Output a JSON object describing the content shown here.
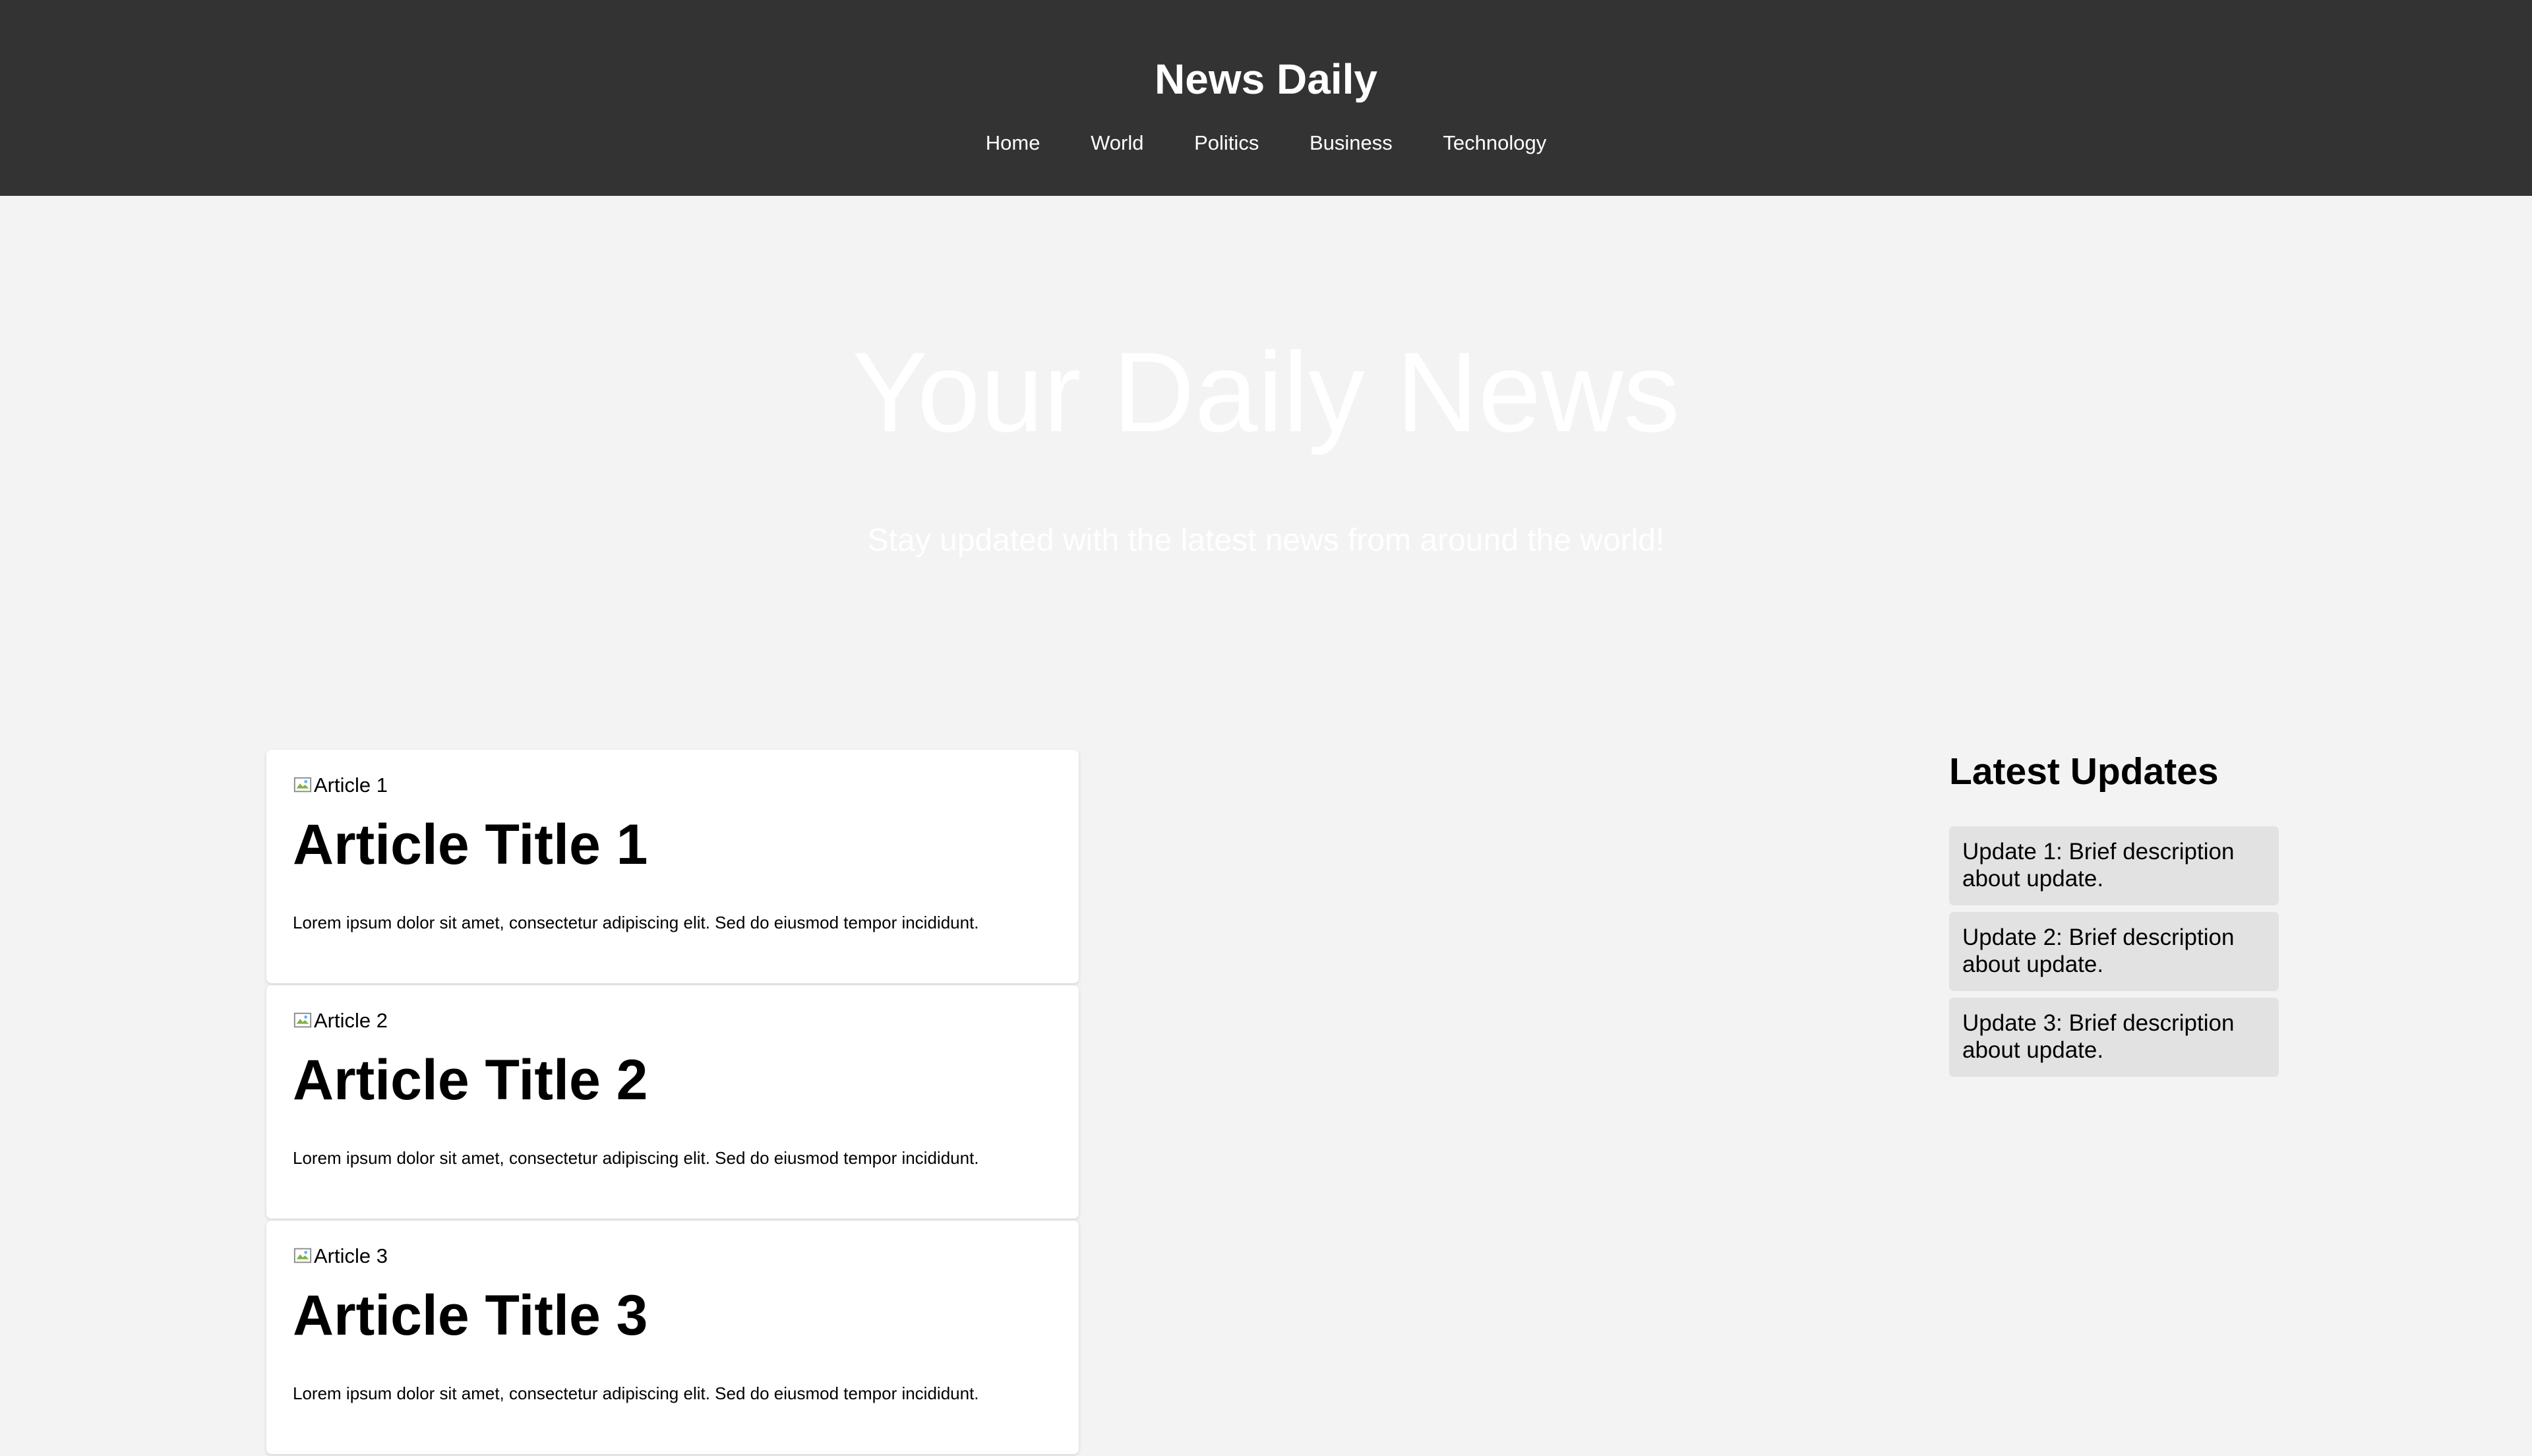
{
  "header": {
    "title": "News Daily",
    "nav": [
      "Home",
      "World",
      "Politics",
      "Business",
      "Technology"
    ]
  },
  "hero": {
    "title": "Your Daily News",
    "subtitle": "Stay updated with the latest news from around the world!"
  },
  "articles": [
    {
      "img_alt": "Article 1",
      "title": "Article Title 1",
      "text": "Lorem ipsum dolor sit amet, consectetur adipiscing elit. Sed do eiusmod tempor incididunt."
    },
    {
      "img_alt": "Article 2",
      "title": "Article Title 2",
      "text": "Lorem ipsum dolor sit amet, consectetur adipiscing elit. Sed do eiusmod tempor incididunt."
    },
    {
      "img_alt": "Article 3",
      "title": "Article Title 3",
      "text": "Lorem ipsum dolor sit amet, consectetur adipiscing elit. Sed do eiusmod tempor incididunt."
    }
  ],
  "sidebar": {
    "title": "Latest Updates",
    "updates": [
      "Update 1: Brief description about update.",
      "Update 2: Brief description about update.",
      "Update 3: Brief description about update."
    ]
  },
  "colors": {
    "header_bg": "#333333",
    "page_bg": "#f3f3f3",
    "update_bg": "#e2e2e2"
  }
}
